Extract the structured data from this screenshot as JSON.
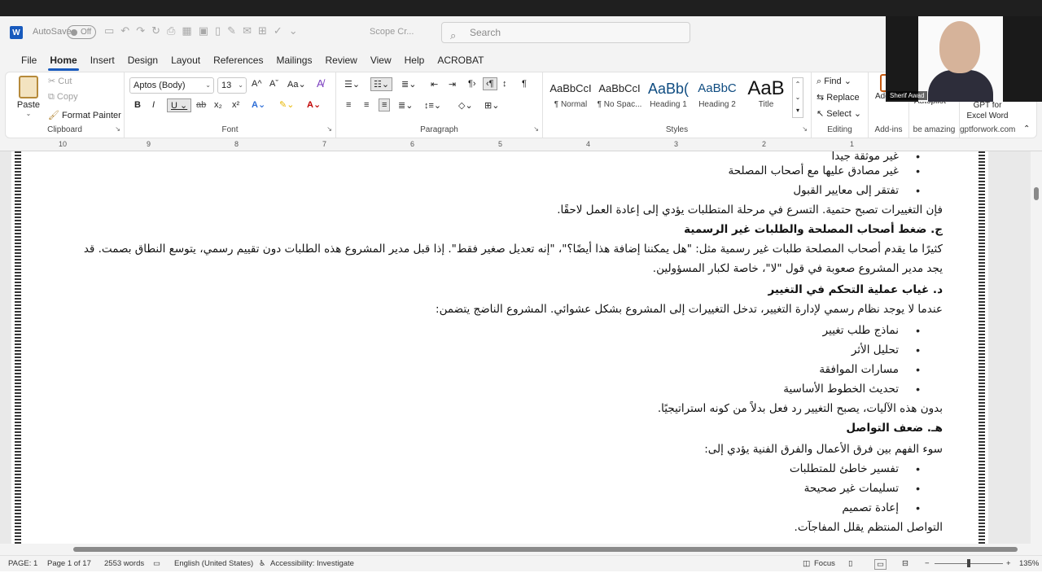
{
  "qat": {
    "autosave_label": "AutoSave",
    "autosave_state": "Off",
    "doc_title": "Scope Cr...",
    "search_placeholder": "Search"
  },
  "tabs": [
    "File",
    "Home",
    "Insert",
    "Design",
    "Layout",
    "References",
    "Mailings",
    "Review",
    "View",
    "Help",
    "ACROBAT"
  ],
  "active_tab": "Home",
  "ribbon": {
    "clipboard": {
      "paste": "Paste",
      "cut": "Cut",
      "copy": "Copy",
      "format_painter": "Format Painter",
      "label": "Clipboard"
    },
    "font": {
      "name": "Aptos (Body)",
      "size": "13",
      "label": "Font"
    },
    "paragraph": {
      "label": "Paragraph"
    },
    "styles": {
      "label": "Styles",
      "items": [
        {
          "sample": "AaBbCcI",
          "name": "¶ Normal"
        },
        {
          "sample": "AaBbCcI",
          "name": "¶ No Spac..."
        },
        {
          "sample": "AaBb(",
          "name": "Heading 1"
        },
        {
          "sample": "AaBbC",
          "name": "Heading 2"
        },
        {
          "sample": "AaB",
          "name": "Title"
        }
      ]
    },
    "editing": {
      "find": "Find",
      "replace": "Replace",
      "select": "Select",
      "label": "Editing"
    },
    "addins": {
      "addins": "Add-ins",
      "label": "Add-ins"
    },
    "autopilot": {
      "name": "Autopilot",
      "label": "be amazing"
    },
    "gpt": {
      "line1": "GPT for",
      "line2": "Excel Word",
      "label": "gptforwork.com"
    }
  },
  "ruler_numbers": [
    "10",
    "9",
    "8",
    "7",
    "6",
    "5",
    "4",
    "3",
    "2",
    "1"
  ],
  "document": {
    "lines": [
      {
        "text": "غير موثقة جيداً",
        "type": "bullet"
      },
      {
        "text": "غير مصادق عليها مع أصحاب المصلحة",
        "type": "bullet"
      },
      {
        "text": "تفتقر إلى معايير القبول",
        "type": "bullet"
      },
      {
        "text": "فإن التغييرات تصبح حتمية. التسرع في مرحلة المتطلبات يؤدي إلى إعادة العمل لاحقًا.",
        "type": "para"
      },
      {
        "text": "ج. ضغط أصحاب المصلحة والطلبات غير الرسمية",
        "type": "heading"
      },
      {
        "text": "كثيرًا ما يقدم أصحاب المصلحة طلبات غير رسمية مثل: \"هل يمكننا إضافة هذا أيضًا؟\"، \"إنه تعديل صغير فقط\". إذا قبل مدير المشروع هذه الطلبات دون تقييم رسمي، يتوسع النطاق بصمت. قد",
        "type": "para"
      },
      {
        "text": "يجد مدير المشروع صعوبة في قول \"لا\"، خاصة لكبار المسؤولين.",
        "type": "para"
      },
      {
        "text": "د. غياب عملية التحكم في التغيير",
        "type": "heading"
      },
      {
        "text": "عندما لا يوجد نظام رسمي لإدارة التغيير، تدخل التغييرات إلى المشروع بشكل عشوائي. المشروع الناضج يتضمن:",
        "type": "para"
      },
      {
        "text": "نماذج طلب تغيير",
        "type": "bullet"
      },
      {
        "text": "تحليل الأثر",
        "type": "bullet"
      },
      {
        "text": "مسارات الموافقة",
        "type": "bullet"
      },
      {
        "text": "تحديث الخطوط الأساسية",
        "type": "bullet"
      },
      {
        "text": "بدون هذه الآليات، يصبح التغيير رد فعل بدلاً من كونه استراتيجيًا.",
        "type": "para"
      },
      {
        "text": "هـ. ضعف التواصل",
        "type": "heading"
      },
      {
        "text": "سوء الفهم بين فرق الأعمال والفرق الفنية يؤدي إلى:",
        "type": "para"
      },
      {
        "text": "تفسير خاطئ للمتطلبات",
        "type": "bullet"
      },
      {
        "text": "تسليمات غير صحيحة",
        "type": "bullet"
      },
      {
        "text": "إعادة تصميم",
        "type": "bullet"
      },
      {
        "text": "التواصل المنتظم يقلل المفاجآت.",
        "type": "para"
      }
    ]
  },
  "status": {
    "page": "PAGE: 1",
    "page_of": "Page 1 of 17",
    "words": "2553 words",
    "language": "English (United States)",
    "accessibility": "Accessibility: Investigate",
    "focus": "Focus",
    "zoom": "135%"
  },
  "webcam": {
    "name": "Sherif Awad"
  }
}
